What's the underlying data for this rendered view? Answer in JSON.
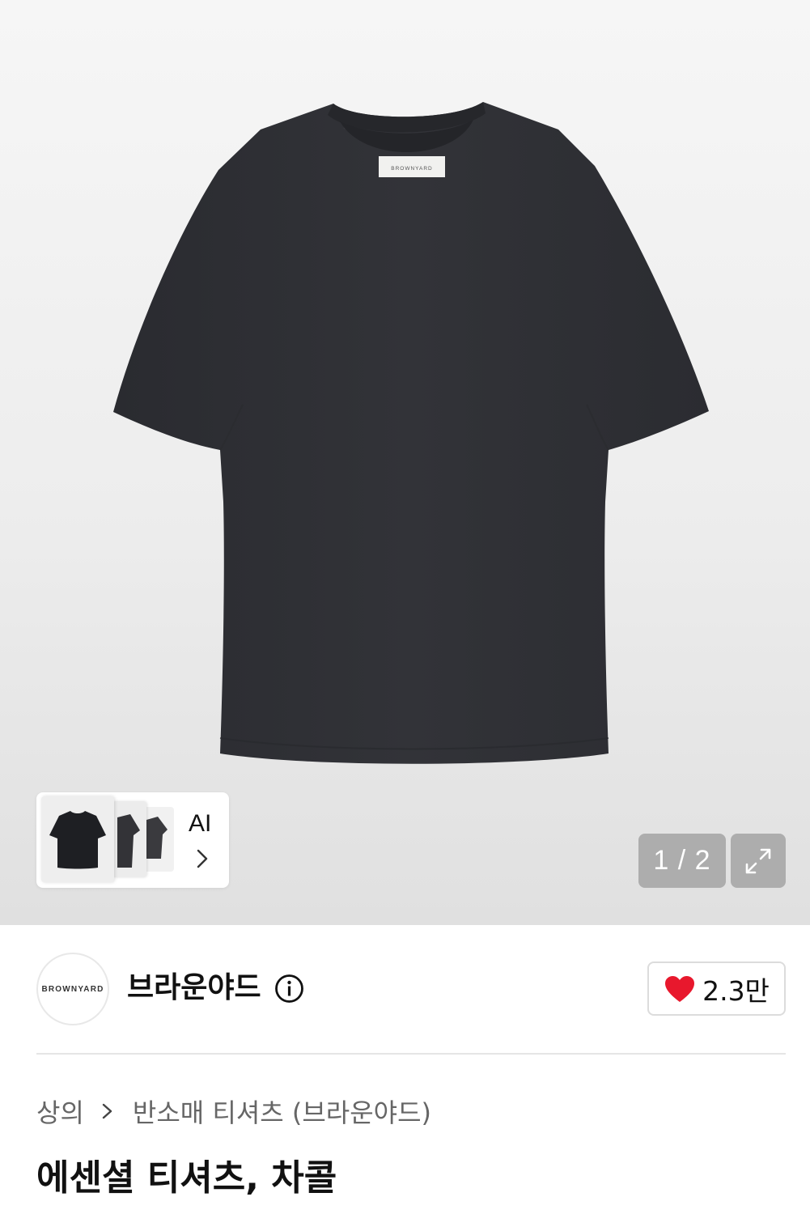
{
  "gallery": {
    "collar_label": "BROWNYARD",
    "pager": "1 / 2",
    "ai_label": "AI"
  },
  "brand": {
    "logo_text": "BROWNYARD",
    "name": "브라운야드",
    "likes": "2.3만"
  },
  "breadcrumb": {
    "category": "상의",
    "subcategory": "반소매 티셔츠 (브라운야드)"
  },
  "product": {
    "title": "에센셜 티셔츠, 차콜"
  },
  "colors": {
    "shirt": "#2f3035",
    "heart": "#e8182d",
    "pager_bg": "#8c8c8c"
  },
  "icons": {
    "expand": "expand-icon",
    "info": "info-icon",
    "heart": "heart-icon",
    "chevron": "chevron-right-icon"
  }
}
